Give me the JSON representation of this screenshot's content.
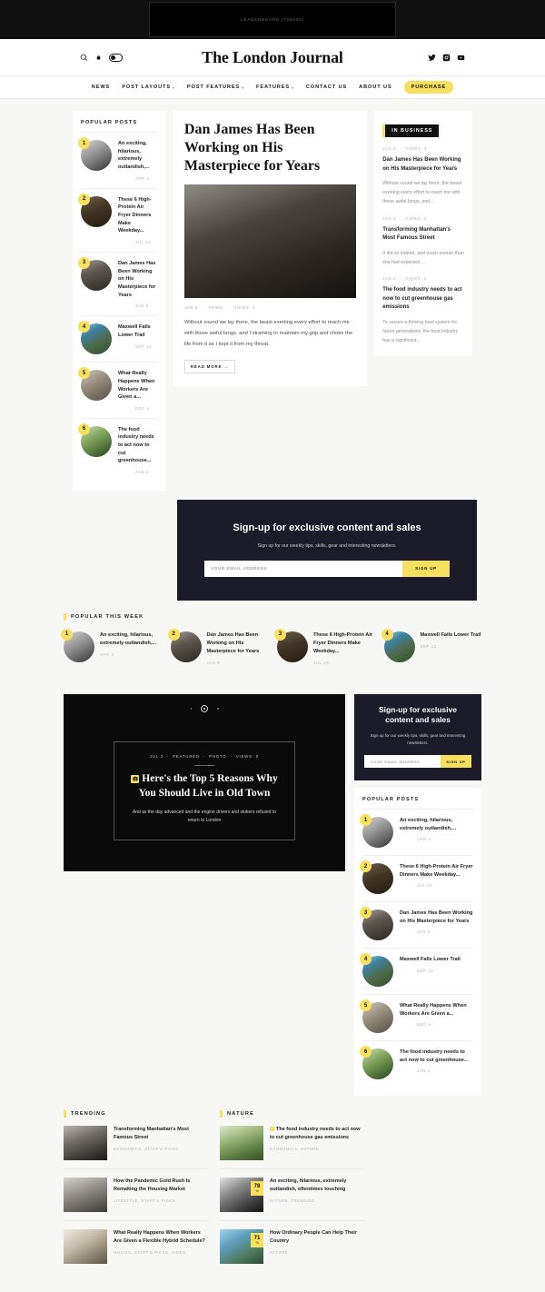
{
  "leaderboard": {
    "label": "LEADERBOARD (728X90)"
  },
  "masthead": {
    "title": "The London Journal",
    "left_icons": [
      "search-icon",
      "flame-icon",
      "dark-mode-toggle"
    ],
    "right_icons": [
      "twitter-icon",
      "instagram-icon",
      "youtube-icon"
    ]
  },
  "nav": {
    "items": [
      {
        "label": "NEWS",
        "has_caret": false
      },
      {
        "label": "POST LAYOUTS",
        "has_caret": true
      },
      {
        "label": "POST FEATURES",
        "has_caret": true
      },
      {
        "label": "FEATURES",
        "has_caret": true
      },
      {
        "label": "CONTACT US",
        "has_caret": false
      },
      {
        "label": "ABOUT US",
        "has_caret": false
      }
    ],
    "purchase_label": "PURCHASE"
  },
  "popular_posts": {
    "heading": "POPULAR POSTS",
    "items": [
      {
        "rank": "1",
        "title": "An exciting, hilarious, extremely outlandish,...",
        "date": "APR 4",
        "img": "img-bride"
      },
      {
        "rank": "2",
        "title": "These 6 High-Protein Air Fryer Dinners Make Weekday...",
        "date": "JUL 23",
        "img": "img-dinner"
      },
      {
        "rank": "3",
        "title": "Dan James Has Been Working on His Masterpiece for Years",
        "date": "JAN 9",
        "img": "img-dan"
      },
      {
        "rank": "4",
        "title": "Maxwell Falls Lower Trail",
        "date": "SEP 12",
        "img": "img-falls"
      },
      {
        "rank": "5",
        "title": "What Really Happens When Workers Are Given a...",
        "date": "DEC 4",
        "img": "img-workers"
      },
      {
        "rank": "6",
        "title": "The food industry needs to act now to cut greenhouse...",
        "date": "JAN 2",
        "img": "img-food"
      }
    ]
  },
  "featured_article": {
    "title": "Dan James Has Been Working on His Masterpiece for Years",
    "date": "JAN 9",
    "category": "NEWS",
    "views": "VIEWS: 3",
    "excerpt": "Without sound we lay there, the beast exerting every effort to reach me with those awful fangs, and I straining to maintain my grip and choke the life from it as I kept it from my throat.",
    "read_more": "READ MORE →"
  },
  "in_business": {
    "badge": "IN BUSINESS",
    "items": [
      {
        "date": "JAN 9",
        "views": "VIEWS: 3",
        "title": "Dan James Has Been Working on His Masterpiece for Years",
        "excerpt": "Without sound we lay there, the beast exerting every effort to reach me with those awful fangs, and..."
      },
      {
        "date": "JAN 3",
        "views": "VIEWS: 2",
        "title": "Transforming Manhattan's Most Famous Street",
        "excerpt": "It did so indeed, and much sooner than she had expected ..."
      },
      {
        "date": "JAN 2",
        "views": "VIEWS: 2",
        "title": "The food industry needs to act now to cut greenhouse gas emissions",
        "excerpt": "To secure a thriving food system for future generations, the food industry has a significant..."
      }
    ]
  },
  "newsletter_wide": {
    "title": "Sign-up for exclusive content and sales",
    "subtitle": "Sign up for our weekly tips, skills, gear and interesting newsletters.",
    "placeholder": "YOUR EMAIL ADDRESS",
    "button": "SIGN UP"
  },
  "popular_week": {
    "heading": "POPULAR THIS WEEK",
    "items": [
      {
        "rank": "1",
        "title": "An exciting, hilarious, extremely outlandish,...",
        "date": "APR 4",
        "img": "img-bride"
      },
      {
        "rank": "2",
        "title": "Dan James Has Been Working on His Masterpiece for Years",
        "date": "JAN 9",
        "img": "img-dan"
      },
      {
        "rank": "3",
        "title": "These 6 High-Protein Air Fryer Dinners Make Weekday...",
        "date": "JUL 23",
        "img": "img-dinner"
      },
      {
        "rank": "4",
        "title": "Maxwell Falls Lower Trail",
        "date": "SEP 12",
        "img": "img-falls"
      }
    ]
  },
  "hero": {
    "date": "JUL 2",
    "cat1": "FEATURED",
    "cat2": "PHOTO",
    "views": "VIEWS: 0",
    "title": "Here's the Top 5 Reasons Why You Should Live in Old Town",
    "excerpt": "And as the day advanced and the engine drivers and stokers refused to return to London"
  },
  "newsletter_small": {
    "title": "Sign-up for exclusive content and sales",
    "subtitle": "Sign up for our weekly tips, skills, gear and interesting newsletters.",
    "placeholder": "YOUR EMAIL ADDRESS",
    "button": "SIGN UP"
  },
  "popular_posts_2": {
    "heading": "POPULAR POSTS",
    "items": [
      {
        "rank": "1",
        "title": "An exciting, hilarious, extremely outlandish,...",
        "date": "APR 4",
        "img": "img-bride"
      },
      {
        "rank": "2",
        "title": "These 6 High-Protein Air Fryer Dinners Make Weekday...",
        "date": "JUL 23",
        "img": "img-dinner"
      },
      {
        "rank": "3",
        "title": "Dan James Has Been Working on His Masterpiece for Years",
        "date": "JAN 9",
        "img": "img-dan"
      },
      {
        "rank": "4",
        "title": "Maxwell Falls Lower Trail",
        "date": "SEP 12",
        "img": "img-falls"
      },
      {
        "rank": "5",
        "title": "What Really Happens When Workers Are Given a...",
        "date": "DEC 4",
        "img": "img-workers"
      },
      {
        "rank": "6",
        "title": "The food industry needs to act now to cut greenhouse...",
        "date": "JAN 2",
        "img": "img-food"
      }
    ]
  },
  "trending": {
    "heading": "TRENDING",
    "items": [
      {
        "title": "Transforming Manhattan's Most Famous Street",
        "cats": "ECONOMICS, STAFF'S PICKS",
        "img": "img-street"
      },
      {
        "title": "How the Pandemic Gold Rush Is Remaking the Housing Market",
        "cats": "LIFESTYLE, STAFF'S PICKS",
        "img": "img-house"
      },
      {
        "title": "What Really Happens When Workers Are Given a Flexible Hybrid Schedule?",
        "cats": "MOVIES, STAFF'S PICKS, VIDEO",
        "img": "img-hybrid"
      }
    ]
  },
  "nature": {
    "heading": "NATURE",
    "items": [
      {
        "title": "The food industry needs to act now to cut greenhouse gas emissions",
        "cats": "ECONOMICS, NATURE",
        "img": "img-green",
        "badge": true,
        "score": "",
        "score_unit": ""
      },
      {
        "title": "An exciting, hilarious, extremely outlandish, oftentimes touching",
        "cats": "NATURE, TRENDING",
        "img": "img-woman",
        "badge": false,
        "score": "78",
        "score_unit": "%"
      },
      {
        "title": "How Ordinary People Can Help Their Country",
        "cats": "NATURE",
        "img": "img-boat",
        "badge": false,
        "score": "71",
        "score_unit": "%"
      }
    ]
  },
  "colors": {
    "accent": "#f6e05e",
    "dark": "#1b1b29",
    "ink": "#111111",
    "page_bg": "#f7f7f5"
  }
}
